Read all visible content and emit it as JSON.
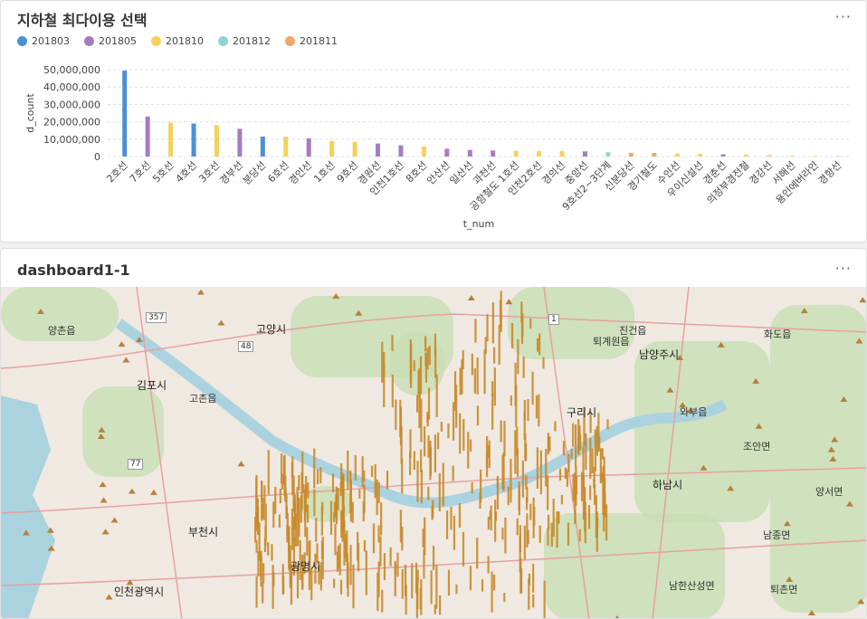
{
  "panel1": {
    "title": "지하철 최다이용 선택",
    "menu_icon": "more-horizontal-icon"
  },
  "legend": [
    {
      "label": "201803",
      "color": "#4a90d9"
    },
    {
      "label": "201805",
      "color": "#a57cc4"
    },
    {
      "label": "201810",
      "color": "#f5d15a"
    },
    {
      "label": "201812",
      "color": "#8fd6d0"
    },
    {
      "label": "201811",
      "color": "#f0a868"
    }
  ],
  "chart_data": {
    "type": "bar",
    "xlabel": "t_num",
    "ylabel": "d_count",
    "ylim": [
      0,
      50000000
    ],
    "yticks": [
      "0",
      "10,000,000",
      "20,000,000",
      "30,000,000",
      "40,000,000",
      "50,000,000"
    ],
    "grid": true,
    "categories": [
      "2호선",
      "7호선",
      "5호선",
      "4호선",
      "3호선",
      "경부선",
      "분당선",
      "6호선",
      "경인선",
      "1호선",
      "9호선",
      "경원선",
      "인천1호선",
      "8호선",
      "안산선",
      "일산선",
      "과천선",
      "공항철도 1호선",
      "인천2호선",
      "경의선",
      "중앙선",
      "9호선2~3단계",
      "신분당선",
      "경기철도",
      "수인선",
      "우이신설선",
      "경춘선",
      "의정부경전철",
      "경강선",
      "서해선",
      "용인에버라인",
      "경항선"
    ],
    "values": [
      49500000,
      23000000,
      19500000,
      19000000,
      18000000,
      16000000,
      11500000,
      11500000,
      10500000,
      9000000,
      8500000,
      7500000,
      6500000,
      5800000,
      4500000,
      3800000,
      3500000,
      3300000,
      3200000,
      3200000,
      3000000,
      2500000,
      2200000,
      2100000,
      1700000,
      1500000,
      1300000,
      1100000,
      900000,
      500000,
      400000,
      300000
    ],
    "series_of_category": [
      "201803",
      "201805",
      "201810",
      "201803",
      "201810",
      "201805",
      "201803",
      "201810",
      "201805",
      "201810",
      "201810",
      "201805",
      "201805",
      "201810",
      "201805",
      "201805",
      "201805",
      "201810",
      "201810",
      "201810",
      "201805",
      "201812",
      "201811",
      "201811",
      "201810",
      "201810",
      "201805",
      "201810",
      "201810",
      "201810",
      "201810",
      "201812"
    ]
  },
  "panel2": {
    "title": "dashboard1-1",
    "menu_icon": "more-horizontal-icon"
  },
  "map": {
    "places": [
      "고양시",
      "김포시",
      "남양주시",
      "구리시",
      "하남시",
      "부천시",
      "광명시",
      "인천광역시",
      "양촌읍",
      "고촌읍",
      "진건읍",
      "화도읍",
      "와부읍",
      "조안면",
      "양서면",
      "남종면",
      "퇴촌면",
      "남한산성면",
      "퇴계원읍"
    ],
    "numbers": [
      "357",
      "77",
      "48",
      "1"
    ]
  }
}
